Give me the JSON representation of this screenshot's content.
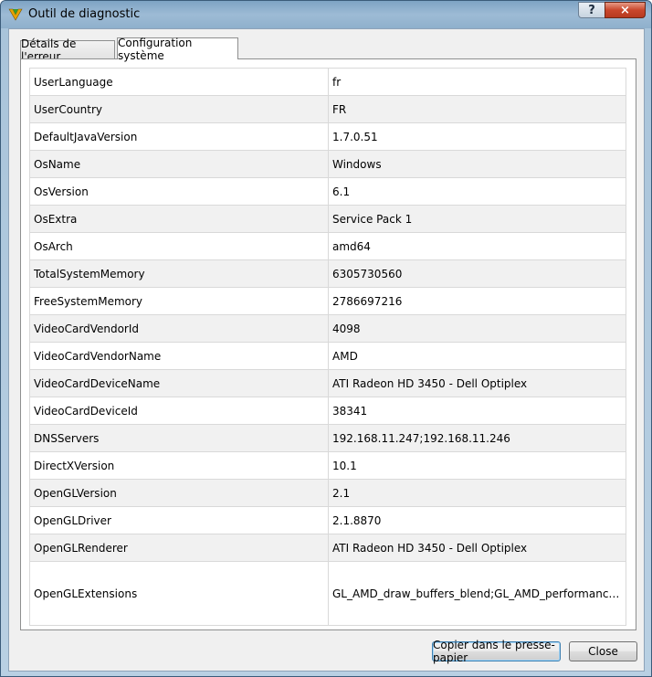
{
  "window": {
    "title": "Outil de diagnostic",
    "help_label": "?",
    "close_label": "×"
  },
  "tabs": [
    {
      "label": "Détails de l'erreur",
      "active": false
    },
    {
      "label": "Configuration système",
      "active": true
    }
  ],
  "rows": [
    {
      "key": "UserLanguage",
      "value": "fr"
    },
    {
      "key": "UserCountry",
      "value": "FR"
    },
    {
      "key": "DefaultJavaVersion",
      "value": "1.7.0.51"
    },
    {
      "key": "OsName",
      "value": "Windows"
    },
    {
      "key": "OsVersion",
      "value": "6.1"
    },
    {
      "key": "OsExtra",
      "value": "Service Pack 1"
    },
    {
      "key": "OsArch",
      "value": "amd64"
    },
    {
      "key": "TotalSystemMemory",
      "value": "6305730560"
    },
    {
      "key": "FreeSystemMemory",
      "value": "2786697216"
    },
    {
      "key": "VideoCardVendorId",
      "value": "4098"
    },
    {
      "key": "VideoCardVendorName",
      "value": "AMD"
    },
    {
      "key": "VideoCardDeviceName",
      "value": "ATI Radeon HD 3450 - Dell Optiplex"
    },
    {
      "key": "VideoCardDeviceId",
      "value": "38341"
    },
    {
      "key": "DNSServers",
      "value": "192.168.11.247;192.168.11.246"
    },
    {
      "key": "DirectXVersion",
      "value": "10.1"
    },
    {
      "key": "OpenGLVersion",
      "value": "2.1"
    },
    {
      "key": "OpenGLDriver",
      "value": "2.1.8870"
    },
    {
      "key": "OpenGLRenderer",
      "value": "ATI Radeon HD 3450 - Dell Optiplex"
    },
    {
      "key": "OpenGLExtensions",
      "value": "GL_AMD_draw_buffers_blend;GL_AMD_performance_moni..."
    }
  ],
  "buttons": {
    "copy_label": "Copier dans le presse-papier",
    "close_label": "Close"
  },
  "colors": {
    "titlebar": "#9dbbd5",
    "close_button": "#c9472c",
    "row_alt": "#f1f1f1"
  }
}
